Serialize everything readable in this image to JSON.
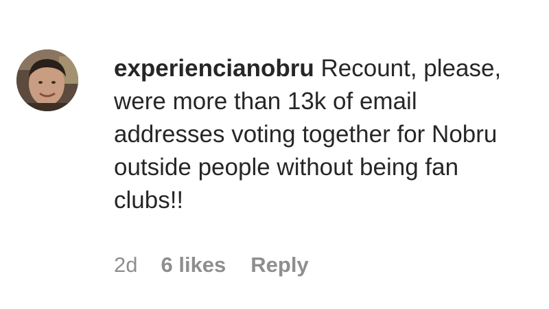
{
  "comment": {
    "username": "experiencianobru",
    "text": "Recount, please, were more than 13k of email addresses voting together for Nobru outside people without being fan clubs!!",
    "time": "2d",
    "likes": "6 likes",
    "reply_label": "Reply"
  },
  "colors": {
    "text": "#262626",
    "meta": "#8e8e8e",
    "background": "#ffffff"
  },
  "icons": {
    "avatar": "user-avatar-photo"
  }
}
